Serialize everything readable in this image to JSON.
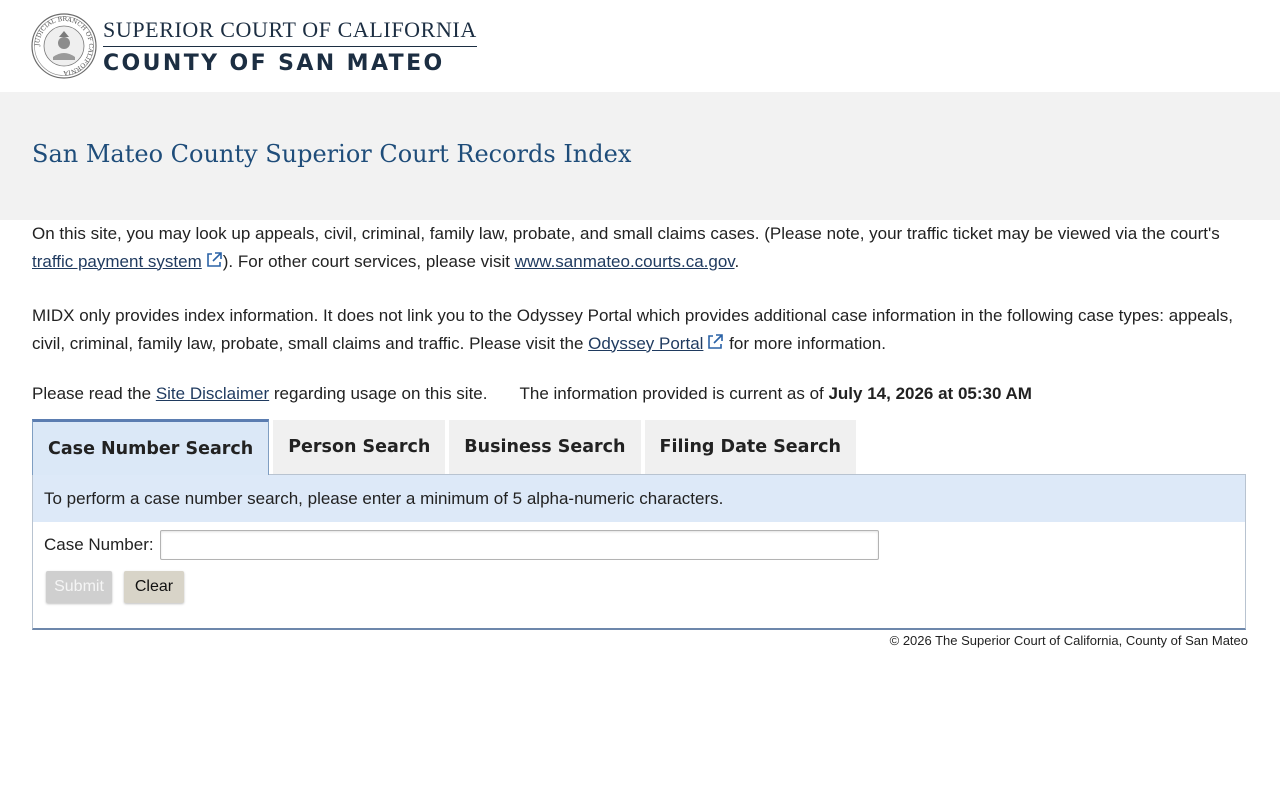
{
  "header": {
    "logo_line1": "SUPERIOR COURT OF CALIFORNIA",
    "logo_line2": "COUNTY OF SAN MATEO",
    "seal_ring_text": "JUDICIAL BRANCH OF CALIFORNIA"
  },
  "page": {
    "title": "San Mateo County Superior Court Records Index"
  },
  "intro": {
    "p1_before": "On this site, you may look up appeals, civil, criminal, family law, probate, and small claims cases. (Please note, your traffic ticket may be viewed via the court's ",
    "p1_link1": "traffic payment system",
    "p1_middle": "). For other court services, please visit ",
    "p1_link2": "www.sanmateo.courts.ca.gov",
    "p1_after": ".",
    "p2_before": "MIDX only provides index information. It does not link you to the Odyssey Portal which provides additional case information in the following case types: appeals, civil, criminal, family law, probate, small claims and traffic. Please visit the ",
    "p2_link": "Odyssey Portal",
    "p2_after": " for more information.",
    "disclaimer_before": "Please read the ",
    "disclaimer_link": "Site Disclaimer",
    "disclaimer_after": " regarding usage on this site.",
    "current_prefix": "The information provided is current as of ",
    "current_date": "July 14, 2026 at 05:30 AM"
  },
  "tabs": [
    {
      "label": "Case Number Search",
      "active": true
    },
    {
      "label": "Person Search",
      "active": false
    },
    {
      "label": "Business Search",
      "active": false
    },
    {
      "label": "Filing Date Search",
      "active": false
    }
  ],
  "panel": {
    "note": "To perform a case number search, please enter a minimum of 5 alpha-numeric characters.",
    "case_label": "Case Number:",
    "case_value": "",
    "submit_label": "Submit",
    "clear_label": "Clear"
  },
  "footer": {
    "copyright": "© 2026 The Superior Court of California, County of San Mateo"
  },
  "colors": {
    "title": "#1f4d7a",
    "link": "#1f3a5f",
    "tab_active_bg": "#dbe8f7",
    "note_bg": "#dde9f8"
  },
  "icons": [
    "court-seal-icon",
    "external-link-icon"
  ]
}
